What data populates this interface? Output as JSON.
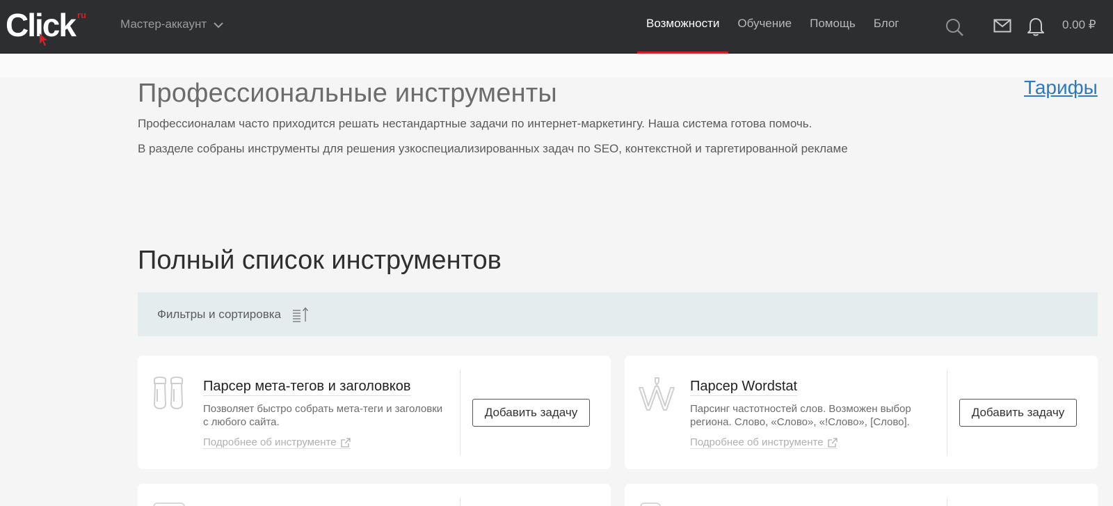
{
  "header": {
    "logo_text": "Click",
    "logo_sup": "ru",
    "account_label": "Мастер-аккаунт",
    "nav": [
      {
        "label": "Возможности",
        "active": true
      },
      {
        "label": "Обучение",
        "active": false
      },
      {
        "label": "Помощь",
        "active": false
      },
      {
        "label": "Блог",
        "active": false
      }
    ],
    "icons": [
      "search-icon",
      "mail-icon",
      "bell-icon"
    ],
    "balance": "0.00 ₽"
  },
  "intro": {
    "title": "Профессиональные инструменты",
    "tariffs_link": "Тарифы",
    "paragraph_1": "Профессионалам часто приходится решать нестандартные задачи по интернет-маркетингу. Наша система готова помочь.",
    "paragraph_2": "В разделе собраны инструменты для решения узкоспециализированных задач по SEO, контекстной и таргетированной рекламе"
  },
  "tools": {
    "section_title": "Полный список инструментов",
    "filter_label": "Фильтры и сортировка",
    "cards": [
      {
        "title": "Парсер мета-тегов и заголовков",
        "description": "Позволяет быстро собрать мета-теги и заголовки с любого сайта.",
        "more_link": "Подробнее об инструменте",
        "button": "Добавить задачу",
        "icon": "binoculars-icon"
      },
      {
        "title": "Парсер Wordstat",
        "description": "Парсинг частотностей слов. Возможен выбор региона. Слово, «Слово», «!Слово», [Слово].",
        "more_link": "Подробнее об инструменте",
        "button": "Добавить задачу",
        "icon": "wordstat-icon"
      }
    ]
  },
  "colors": {
    "header_bg": "#2c2e30",
    "accent_red": "#d32027",
    "link_blue": "#2b7bc1",
    "filter_bg": "#e4ecee",
    "page_bg": "#f5f5f5"
  }
}
